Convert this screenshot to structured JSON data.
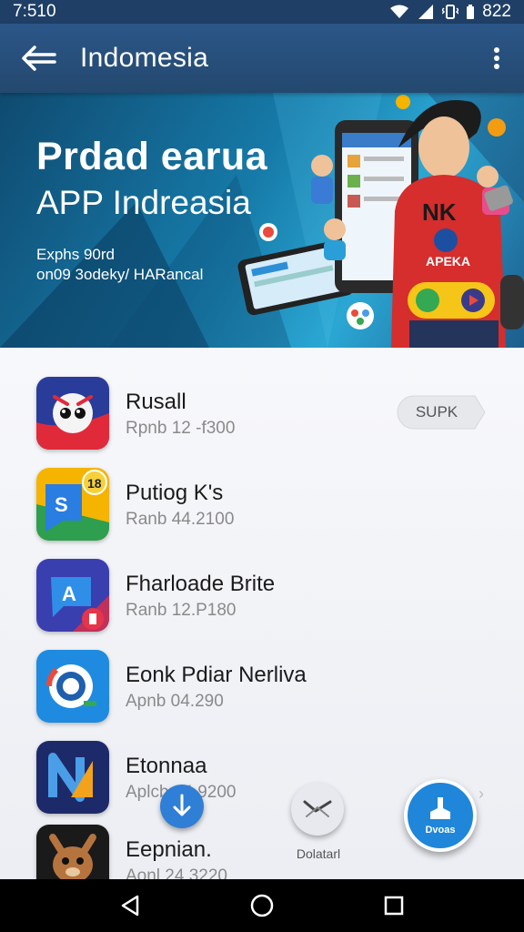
{
  "status_bar": {
    "time": "7:510",
    "battery": "822"
  },
  "app_bar": {
    "title": "Indomesia"
  },
  "banner": {
    "title": "Prdad earua",
    "subtitle": "APP Indreasia",
    "line1": "Exphs 90rd",
    "line2": "on09 3odeky/ HARancal",
    "shirt_text_top": "NK",
    "shirt_text_bottom": "APEKA"
  },
  "apps": [
    {
      "name": "Rusall",
      "meta": "Rpnb 12 -f300",
      "action": "SUPK",
      "colors": [
        "#2a3c9a",
        "#e02a3a"
      ]
    },
    {
      "name": "Putiog K's",
      "meta": "Ranb 44.2100",
      "badge": "18",
      "colors": [
        "#f4b400",
        "#2e9e4f"
      ]
    },
    {
      "name": "Fharloade Brite",
      "meta": "Ranb 12.P180",
      "colors": [
        "#3a3fb0",
        "#c0305a"
      ]
    },
    {
      "name": "Eonk Pdiar Nerliva",
      "meta": "Apnb 04.290",
      "colors": [
        "#1e8be0",
        "#27a7f0"
      ]
    },
    {
      "name": "Etonnaa",
      "meta": "Aplcb 34.9200",
      "colors": [
        "#1d2a6a",
        "#f3a21b"
      ]
    },
    {
      "name": "Eepnian.",
      "meta": "Aonl 24.3220",
      "colors": [
        "#1a1a1a",
        "#b5743e"
      ]
    }
  ],
  "fab": {
    "middle_label": "Dolatarl",
    "right_label": "Dvoas"
  },
  "icons": {
    "back": "arrow-left-icon",
    "menu": "more-vert-icon",
    "nav_back": "triangle-back-icon",
    "nav_home": "circle-home-icon",
    "nav_recent": "square-recent-icon"
  }
}
